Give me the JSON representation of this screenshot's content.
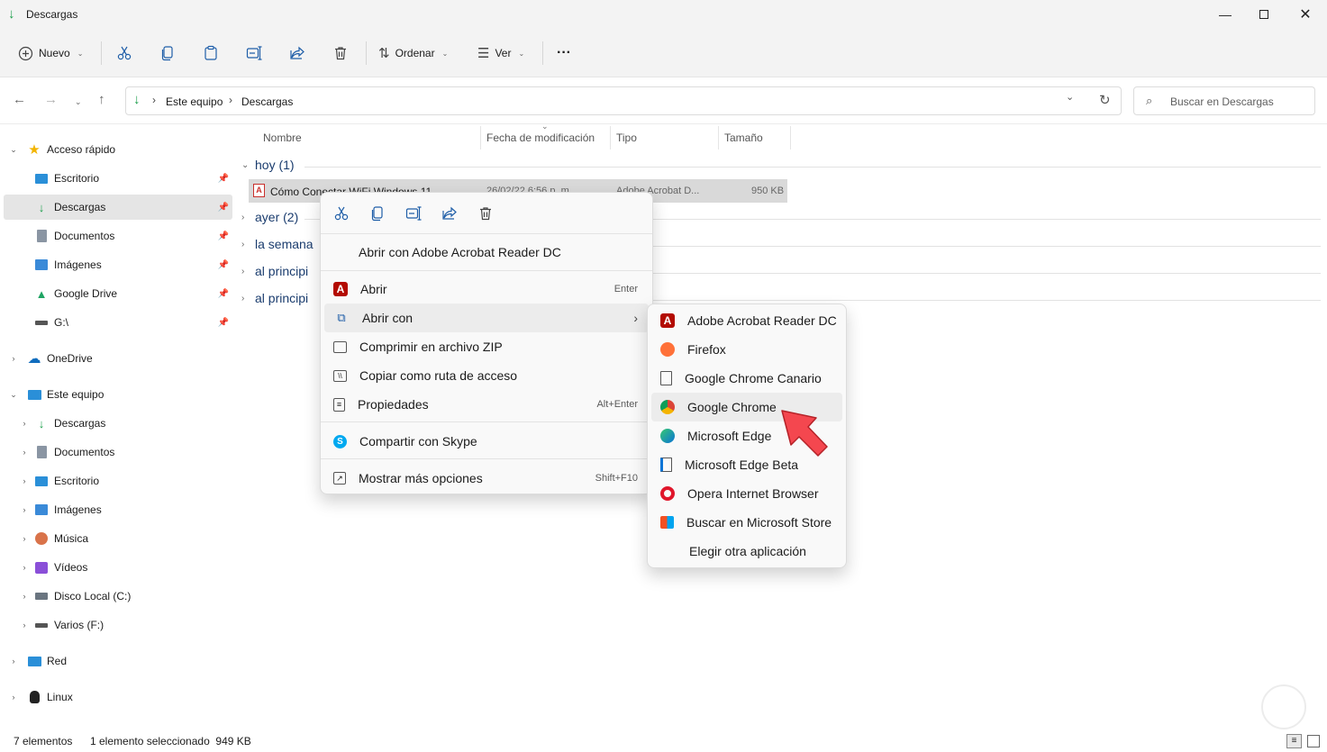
{
  "window": {
    "title": "Descargas",
    "minimize_icon": "minimize-icon",
    "maximize_icon": "maximize-icon",
    "close_icon": "close-icon"
  },
  "toolbar": {
    "new_label": "Nuevo",
    "sort_label": "Ordenar",
    "view_label": "Ver",
    "more_label": "···"
  },
  "address": {
    "crumbs": [
      "Este equipo",
      "Descargas"
    ],
    "search_placeholder": "Buscar en Descargas"
  },
  "sidebar": {
    "quick_access": "Acceso rápido",
    "quick_items": [
      "Escritorio",
      "Descargas",
      "Documentos",
      "Imágenes",
      "Google Drive",
      "G:\\"
    ],
    "onedrive": "OneDrive",
    "this_pc": "Este equipo",
    "pc_items": [
      "Descargas",
      "Documentos",
      "Escritorio",
      "Imágenes",
      "Música",
      "Vídeos",
      "Disco Local (C:)",
      "Varios (F:)"
    ],
    "network": "Red",
    "linux": "Linux"
  },
  "columns": {
    "name": "Nombre",
    "date": "Fecha de modificación",
    "type": "Tipo",
    "size": "Tamaño"
  },
  "groups": [
    "hoy (1)",
    "ayer (2)",
    "la semana",
    "al principi",
    "al principi"
  ],
  "file": {
    "name": "Cómo Conectar WiFi Windows 11",
    "date": "26/02/22 6:56 p. m.",
    "type": "Adobe Acrobat D...",
    "size": "950 KB"
  },
  "context_menu": {
    "open_with_acrobat": "Abrir con Adobe Acrobat Reader DC",
    "open": "Abrir",
    "open_shortcut": "Enter",
    "open_with": "Abrir con",
    "compress": "Comprimir en archivo ZIP",
    "copy_path": "Copiar como ruta de acceso",
    "properties": "Propiedades",
    "properties_shortcut": "Alt+Enter",
    "share_skype": "Compartir con Skype",
    "more_options": "Mostrar más opciones",
    "more_options_shortcut": "Shift+F10"
  },
  "submenu": {
    "items": [
      "Adobe Acrobat Reader DC",
      "Firefox",
      "Google Chrome Canario",
      "Google Chrome",
      "Microsoft Edge",
      "Microsoft Edge Beta",
      "Opera Internet Browser",
      "Buscar en Microsoft Store",
      "Elegir otra aplicación"
    ],
    "highlighted": "Google Chrome"
  },
  "status": {
    "count": "7 elementos",
    "selection": "1 elemento seleccionado  949 KB"
  },
  "colors": {
    "accent": "#0f6cbd",
    "selection": "#d9d9d9",
    "menu_bg": "#f9f9f9",
    "pointer": "#f4474f"
  }
}
